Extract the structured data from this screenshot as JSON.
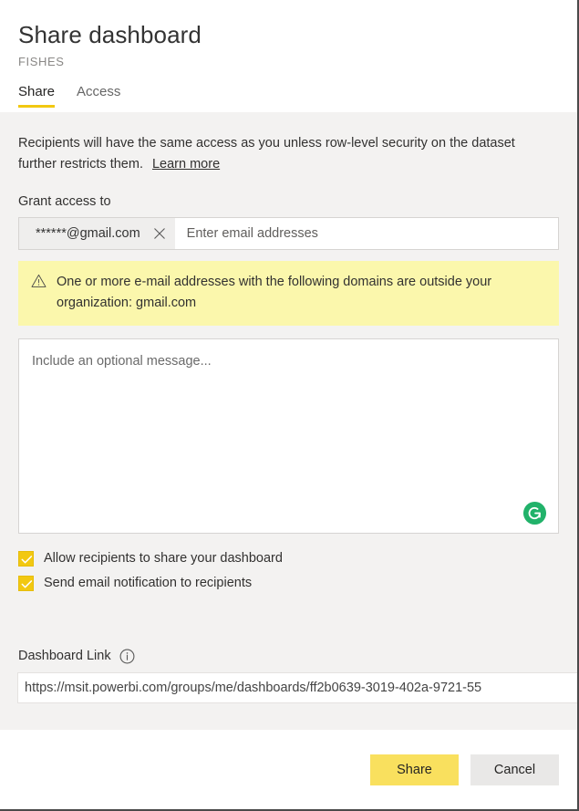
{
  "header": {
    "title": "Share dashboard",
    "subtitle": "FISHES",
    "tabs": [
      {
        "label": "Share",
        "active": true
      },
      {
        "label": "Access",
        "active": false
      }
    ]
  },
  "main": {
    "intro_text": "Recipients will have the same access as you unless row-level security on the dataset further restricts them.",
    "learn_more_label": "Learn more",
    "grant_access_label": "Grant access to",
    "recipients": {
      "pill_email": "******@gmail.com",
      "remove_icon": "close-x-icon",
      "placeholder": "Enter email addresses",
      "value": ""
    },
    "warning": {
      "icon": "warning-triangle-icon",
      "text": "One or more e-mail addresses with the following domains are outside your organization: gmail.com",
      "background_color": "#fbf7ac"
    },
    "message": {
      "placeholder": "Include an optional message...",
      "value": "",
      "assistant_icon": "grammarly-icon",
      "assistant_color": "#21b26a"
    },
    "checkboxes": [
      {
        "label": "Allow recipients to share your dashboard",
        "checked": true
      },
      {
        "label": "Send email notification to recipients",
        "checked": true
      }
    ],
    "dashboard_link": {
      "label": "Dashboard Link",
      "info_icon": "info-circle-icon",
      "url": "https://msit.powerbi.com/groups/me/dashboards/ff2b0639-3019-402a-9721-55"
    }
  },
  "footer": {
    "share_label": "Share",
    "cancel_label": "Cancel"
  },
  "colors": {
    "accent_yellow": "#f2c811",
    "primary_button": "#f9e05e",
    "body_background": "#f3f2f1",
    "warning_background": "#fbf7ac"
  }
}
